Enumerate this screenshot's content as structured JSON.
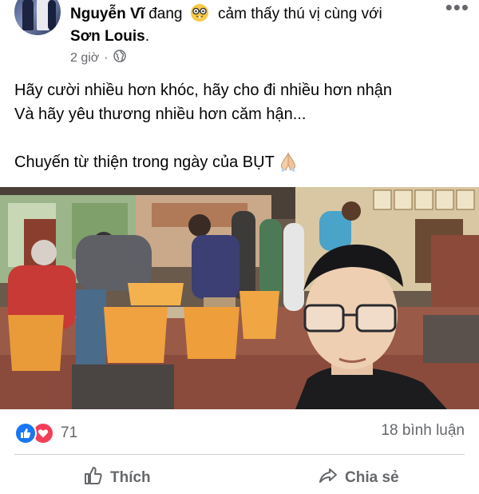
{
  "post": {
    "author": "Nguyễn Vĩ",
    "status_pre": "đang",
    "status_feeling": "cảm thấy thú vị cùng với",
    "tagged": "Sơn Louis",
    "tagged_suffix": ".",
    "time": "2 giờ",
    "separator": "·",
    "privacy_icon": "globe-icon",
    "text_lines": [
      "Hãy cười nhiều hơn khóc, hãy cho đi nhiều hơn nhận",
      "Và hãy yêu thương nhiều hơn căm hận...",
      "",
      "Chuyến từ thiện trong ngày của BỤT"
    ]
  },
  "footer": {
    "reaction_count": "71",
    "comments": "18 bình luận",
    "like_label": "Thích",
    "share_label": "Chia sẻ"
  },
  "colors": {
    "accent": "#1877f2",
    "love": "#f33e58",
    "muted": "#65676b"
  }
}
